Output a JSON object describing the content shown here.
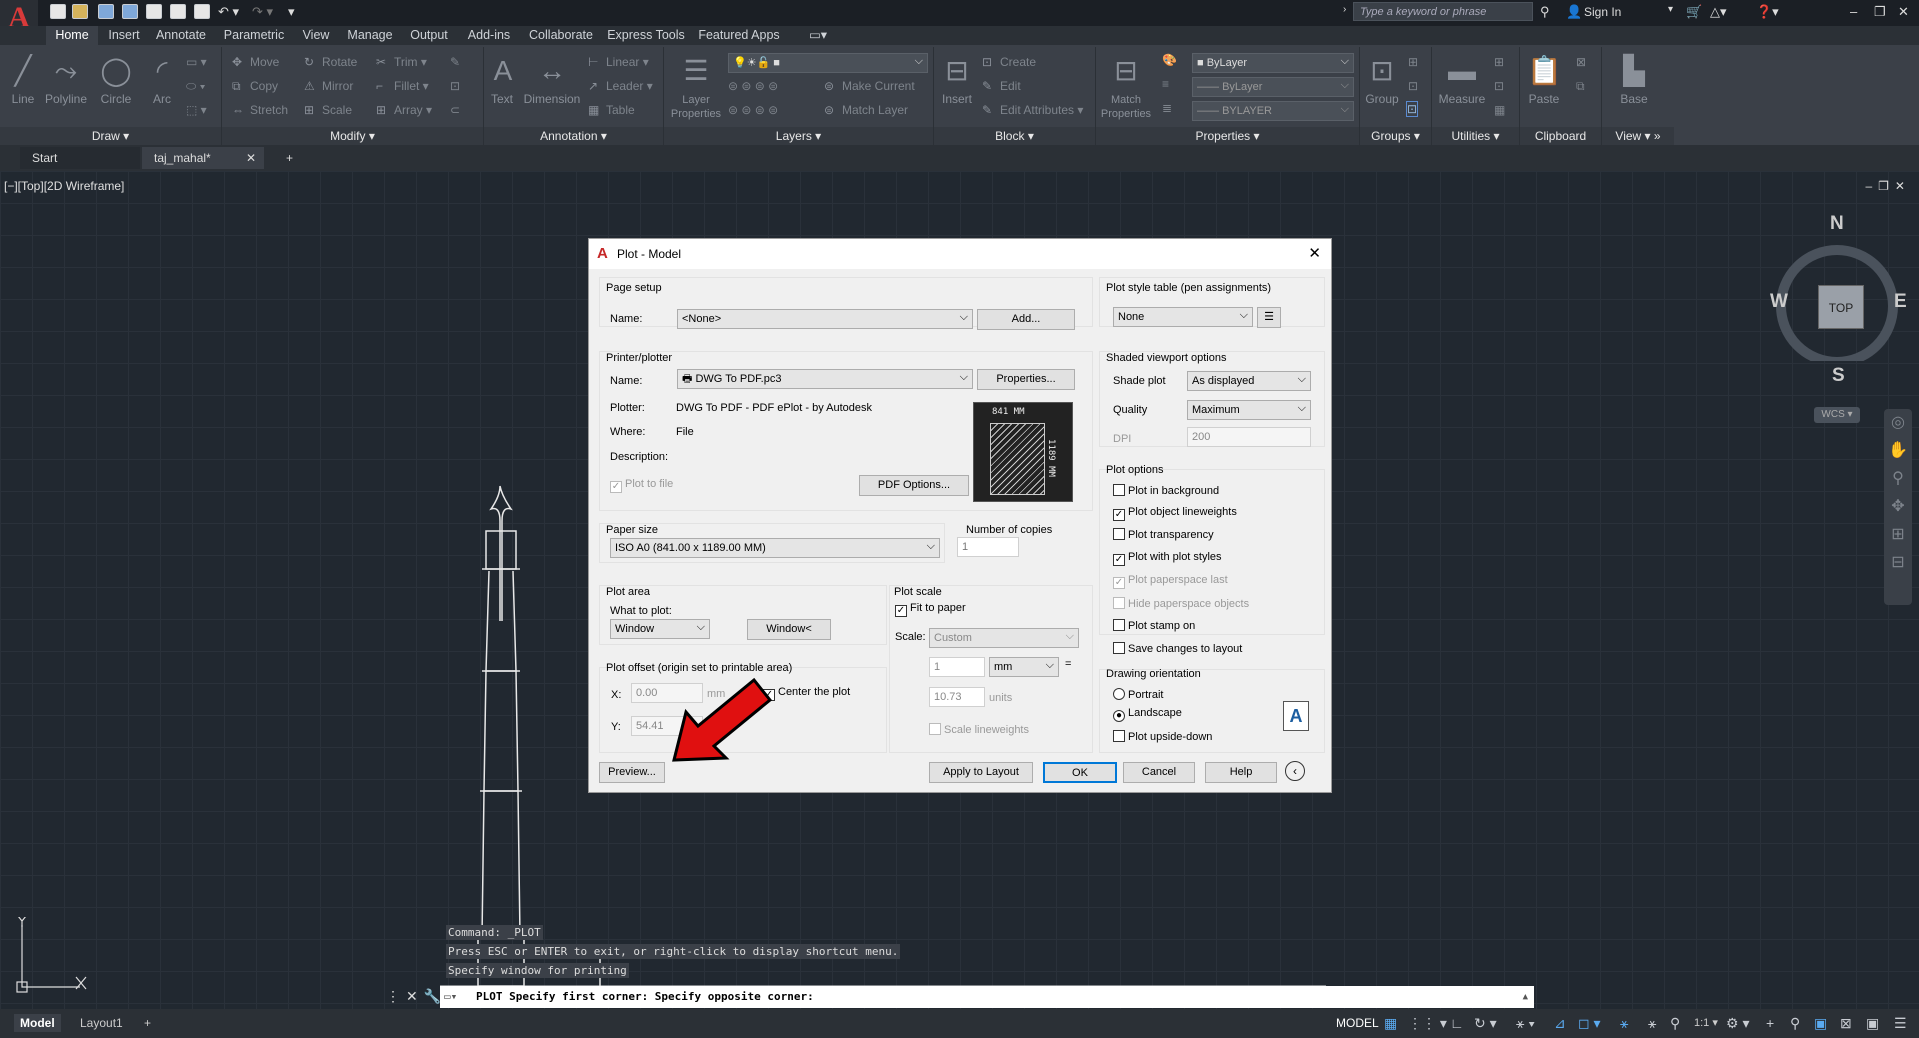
{
  "app": {
    "logo": "A"
  },
  "titlebar": {
    "search_placeholder": "Type a keyword or phrase",
    "sign_in": "Sign In"
  },
  "menu_tabs": [
    "Home",
    "Insert",
    "Annotate",
    "Parametric",
    "View",
    "Manage",
    "Output",
    "Add-ins",
    "Collaborate",
    "Express Tools",
    "Featured Apps"
  ],
  "ribbon": {
    "draw": {
      "title": "Draw",
      "line": "Line",
      "polyline": "Polyline",
      "circle": "Circle",
      "arc": "Arc"
    },
    "modify": {
      "title": "Modify",
      "move": "Move",
      "rotate": "Rotate",
      "trim": "Trim",
      "copy": "Copy",
      "mirror": "Mirror",
      "fillet": "Fillet",
      "stretch": "Stretch",
      "scale": "Scale",
      "array": "Array"
    },
    "annotation": {
      "title": "Annotation",
      "text": "Text",
      "dimension": "Dimension",
      "linear": "Linear",
      "leader": "Leader",
      "table": "Table"
    },
    "layers": {
      "title": "Layers",
      "layer_properties": "Layer Properties",
      "make_current": "Make Current",
      "match_layer": "Match Layer"
    },
    "block": {
      "title": "Block",
      "insert": "Insert",
      "create": "Create",
      "edit": "Edit",
      "edit_attributes": "Edit Attributes"
    },
    "properties": {
      "title": "Properties",
      "match_properties": "Match Properties",
      "bylayer1": "ByLayer",
      "bylayer2": "ByLayer",
      "bylayer3": "BYLAYER"
    },
    "groups": {
      "title": "Groups",
      "group": "Group"
    },
    "utilities": {
      "title": "Utilities",
      "measure": "Measure"
    },
    "clipboard": {
      "title": "Clipboard",
      "paste": "Paste"
    },
    "view": {
      "title": "View",
      "base": "Base"
    }
  },
  "doc_tabs": {
    "start": "Start",
    "file": "taj_mahal*",
    "add": "+"
  },
  "viewport": {
    "label": "[−][Top][2D Wireframe]"
  },
  "navcube": {
    "n": "N",
    "s": "S",
    "e": "E",
    "w": "W",
    "top": "TOP",
    "wcs": "WCS"
  },
  "dialog": {
    "title": "Plot - Model",
    "page_setup": {
      "label": "Page setup",
      "name_label": "Name:",
      "name_value": "<None>",
      "add": "Add..."
    },
    "printer": {
      "label": "Printer/plotter",
      "name_label": "Name:",
      "name_value": "DWG To PDF.pc3",
      "properties": "Properties...",
      "plotter_label": "Plotter:",
      "plotter_value": "DWG To PDF - PDF ePlot - by Autodesk",
      "where_label": "Where:",
      "where_value": "File",
      "description_label": "Description:",
      "plot_to_file": "Plot to file",
      "pdf_options": "PDF Options...",
      "paper_w": "841 MM",
      "paper_h": "1189 MM"
    },
    "paper_size": {
      "label": "Paper size",
      "value": "ISO A0 (841.00 x 1189.00 MM)"
    },
    "copies": {
      "label": "Number of copies",
      "value": "1"
    },
    "plot_area": {
      "label": "Plot area",
      "what_label": "What to plot:",
      "what_value": "Window",
      "window_btn": "Window<"
    },
    "plot_scale": {
      "label": "Plot scale",
      "fit": "Fit to paper",
      "scale_label": "Scale:",
      "scale_value": "Custom",
      "v1": "1",
      "unit": "mm",
      "eq": "=",
      "v2": "10.73",
      "units": "units",
      "scale_lw": "Scale lineweights"
    },
    "offset": {
      "label": "Plot offset (origin set to printable area)",
      "x_label": "X:",
      "x_value": "0.00",
      "y_label": "Y:",
      "y_value": "54.41",
      "mm": "mm",
      "center": "Center the plot"
    },
    "pst": {
      "label": "Plot style table (pen assignments)",
      "value": "None"
    },
    "shaded": {
      "label": "Shaded viewport options",
      "shade_label": "Shade plot",
      "shade_value": "As displayed",
      "quality_label": "Quality",
      "quality_value": "Maximum",
      "dpi_label": "DPI",
      "dpi_value": "200"
    },
    "options": {
      "label": "Plot options",
      "o1": "Plot in background",
      "o2": "Plot object lineweights",
      "o3": "Plot transparency",
      "o4": "Plot with plot styles",
      "o5": "Plot paperspace last",
      "o6": "Hide paperspace objects",
      "o7": "Plot stamp on",
      "o8": "Save changes to layout"
    },
    "orientation": {
      "label": "Drawing orientation",
      "portrait": "Portrait",
      "landscape": "Landscape",
      "upside": "Plot upside-down"
    },
    "buttons": {
      "preview": "Preview...",
      "apply": "Apply to Layout",
      "ok": "OK",
      "cancel": "Cancel",
      "help": "Help"
    }
  },
  "command": {
    "h1": "Command: _PLOT",
    "h2": "Press ESC or ENTER to exit, or right-click to display shortcut menu.",
    "h3": "Specify window for printing",
    "current": "PLOT Specify first corner: Specify opposite corner:"
  },
  "status": {
    "model_tab": "Model",
    "layout1": "Layout1",
    "model": "MODEL",
    "scale": "1:1"
  },
  "colors": {
    "accent": "#0078d7",
    "arrow": "#e01010"
  }
}
